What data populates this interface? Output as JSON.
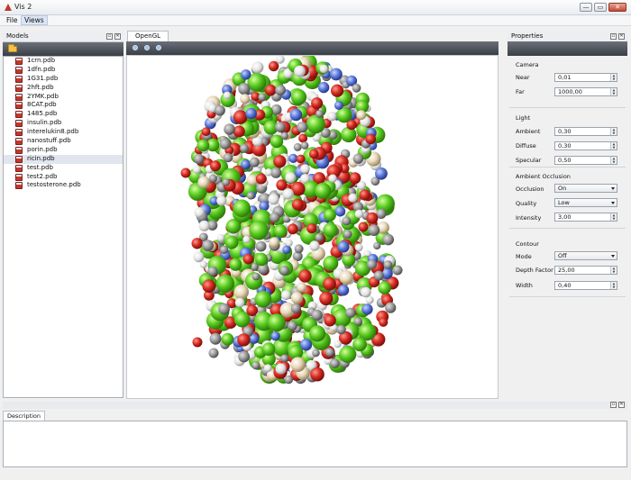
{
  "window": {
    "title": "Vis 2",
    "minimize": "—",
    "maximize": "▭",
    "close": "✕"
  },
  "menu": [
    "File",
    "Views"
  ],
  "models_panel": {
    "title": "Models",
    "files": [
      "1crn.pdb",
      "1dfn.pdb",
      "1G31.pdb",
      "2hft.pdb",
      "2YMK.pdb",
      "8CAT.pdb",
      "1485.pdb",
      "insulin.pdb",
      "interelukin8.pdb",
      "nanostuff.pdb",
      "porin.pdb",
      "ricin.pdb",
      "test.pdb",
      "test2.pdb",
      "testosterone.pdb"
    ],
    "selected": "ricin.pdb"
  },
  "viewer": {
    "tab": "OpenGL"
  },
  "properties": {
    "title": "Properties",
    "camera": {
      "title": "Camera",
      "near_label": "Near",
      "near": "0,01",
      "far_label": "Far",
      "far": "1000,00"
    },
    "light": {
      "title": "Light",
      "ambient_label": "Ambient",
      "ambient": "0,30",
      "diffuse_label": "Diffuse",
      "diffuse": "0,30",
      "specular_label": "Specular",
      "specular": "0,50"
    },
    "ambient_occlusion": {
      "title": "Ambient Occlusion",
      "occlusion_label": "Occlusion",
      "occlusion": "On",
      "quality_label": "Quality",
      "quality": "Low",
      "intensity_label": "Intensity",
      "intensity": "3,00"
    },
    "contour": {
      "title": "Contour",
      "mode_label": "Mode",
      "mode": "Off",
      "depth_factor_label": "Depth Factor",
      "depth_factor": "25,00",
      "width_label": "Width",
      "width": "0,40"
    }
  },
  "description": {
    "tab": "Description"
  },
  "colors": {
    "carbon": "#55c81e",
    "oxygen": "#d42a22",
    "nitrogen": "#5a78d8",
    "hydrogen": "#e4e4e4",
    "grey": "#9a9a9a",
    "tan": "#e8d8b8"
  }
}
